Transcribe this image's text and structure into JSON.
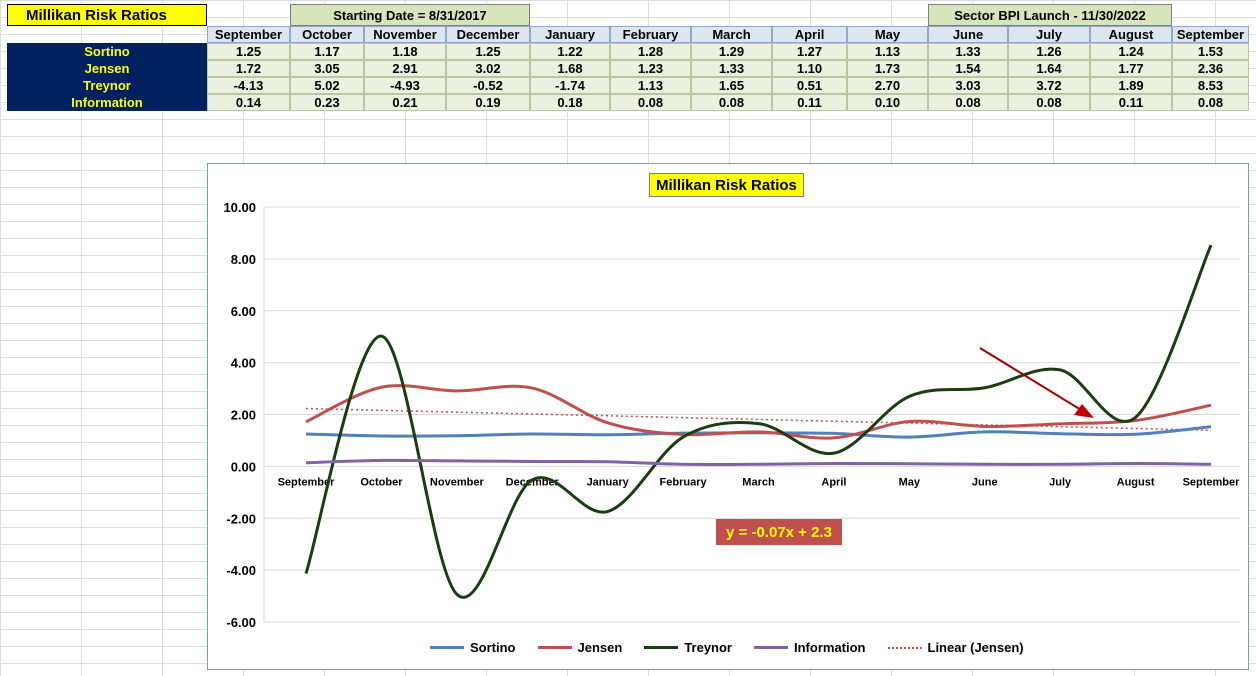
{
  "header": {
    "title": "Millikan Risk Ratios",
    "start_banner": "Starting Date = 8/31/2017",
    "launch_banner": "Sector BPI Launch - 11/30/2022"
  },
  "table": {
    "months": [
      "September",
      "October",
      "November",
      "December",
      "January",
      "February",
      "March",
      "April",
      "May",
      "June",
      "July",
      "August",
      "September"
    ],
    "rows": [
      {
        "label": "Sortino",
        "values": [
          "1.25",
          "1.17",
          "1.18",
          "1.25",
          "1.22",
          "1.28",
          "1.29",
          "1.27",
          "1.13",
          "1.33",
          "1.26",
          "1.24",
          "1.53"
        ]
      },
      {
        "label": "Jensen",
        "values": [
          "1.72",
          "3.05",
          "2.91",
          "3.02",
          "1.68",
          "1.23",
          "1.33",
          "1.10",
          "1.73",
          "1.54",
          "1.64",
          "1.77",
          "2.36"
        ]
      },
      {
        "label": "Treynor",
        "values": [
          "-4.13",
          "5.02",
          "-4.93",
          "-0.52",
          "-1.74",
          "1.13",
          "1.65",
          "0.51",
          "2.70",
          "3.03",
          "3.72",
          "1.89",
          "8.53"
        ]
      },
      {
        "label": "Information",
        "values": [
          "0.14",
          "0.23",
          "0.21",
          "0.19",
          "0.18",
          "0.08",
          "0.08",
          "0.11",
          "0.10",
          "0.08",
          "0.08",
          "0.11",
          "0.08"
        ]
      }
    ]
  },
  "chart_data": {
    "type": "line",
    "title": "Millikan Risk Ratios",
    "categories": [
      "September",
      "October",
      "November",
      "December",
      "January",
      "February",
      "March",
      "April",
      "May",
      "June",
      "July",
      "August",
      "September"
    ],
    "ylim": [
      -6,
      10
    ],
    "yticks": [
      "10.00",
      "8.00",
      "6.00",
      "4.00",
      "2.00",
      "0.00",
      "-2.00",
      "-4.00",
      "-6.00"
    ],
    "series": [
      {
        "name": "Sortino",
        "color": "#4f81bd",
        "values": [
          1.25,
          1.17,
          1.18,
          1.25,
          1.22,
          1.28,
          1.29,
          1.27,
          1.13,
          1.33,
          1.26,
          1.24,
          1.53
        ]
      },
      {
        "name": "Jensen",
        "color": "#c0504d",
        "values": [
          1.72,
          3.05,
          2.91,
          3.02,
          1.68,
          1.23,
          1.33,
          1.1,
          1.73,
          1.54,
          1.64,
          1.77,
          2.36
        ]
      },
      {
        "name": "Treynor",
        "color": "#1a3d12",
        "values": [
          -4.13,
          5.02,
          -4.93,
          -0.52,
          -1.74,
          1.13,
          1.65,
          0.51,
          2.7,
          3.03,
          3.72,
          1.89,
          8.53
        ]
      },
      {
        "name": "Information",
        "color": "#8064a2",
        "values": [
          0.14,
          0.23,
          0.21,
          0.19,
          0.18,
          0.08,
          0.08,
          0.11,
          0.1,
          0.08,
          0.08,
          0.11,
          0.08
        ]
      }
    ],
    "trendline": {
      "name": "Linear (Jensen)",
      "color": "#c0504d",
      "slope": -0.07,
      "intercept": 2.3
    },
    "equation": "y = -0.07x + 2.3",
    "grid": true,
    "legend": "bottom"
  }
}
